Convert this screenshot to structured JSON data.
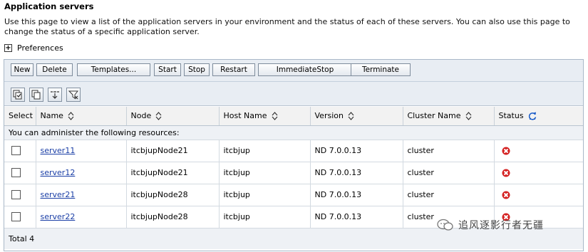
{
  "page": {
    "title": "Application servers",
    "description": "Use this page to view a list of the application servers in your environment and the status of each of these servers. You can also use this page to change the status of a specific application server.",
    "preferences_label": "Preferences"
  },
  "toolbar": {
    "new": "New",
    "delete": "Delete",
    "templates": "Templates...",
    "start": "Start",
    "stop": "Stop",
    "restart": "Restart",
    "immediate_stop": "ImmediateStop",
    "terminate": "Terminate"
  },
  "icon_toolbar": [
    "select-all-icon",
    "deselect-all-icon",
    "filter-show-icon",
    "filter-clear-icon"
  ],
  "table": {
    "headers": {
      "select": "Select",
      "name": "Name",
      "node": "Node",
      "host": "Host Name",
      "version": "Version",
      "cluster": "Cluster Name",
      "status": "Status"
    },
    "message": "You can administer the following resources:",
    "rows": [
      {
        "name": "server11",
        "node": "itcbjupNode21",
        "host": "itcbjup",
        "version": "ND 7.0.0.13",
        "cluster": "cluster",
        "status": "stopped"
      },
      {
        "name": "server12",
        "node": "itcbjupNode21",
        "host": "itcbjup",
        "version": "ND 7.0.0.13",
        "cluster": "cluster",
        "status": "stopped"
      },
      {
        "name": "server21",
        "node": "itcbjupNode28",
        "host": "itcbjup",
        "version": "ND 7.0.0.13",
        "cluster": "cluster",
        "status": "stopped"
      },
      {
        "name": "server22",
        "node": "itcbjupNode28",
        "host": "itcbjup",
        "version": "ND 7.0.0.13",
        "cluster": "cluster",
        "status": "stopped"
      }
    ],
    "total": "Total 4"
  },
  "colors": {
    "link": "#1a3ea6",
    "status_stopped": "#d42020"
  },
  "watermark": "追风逐影行者无疆"
}
